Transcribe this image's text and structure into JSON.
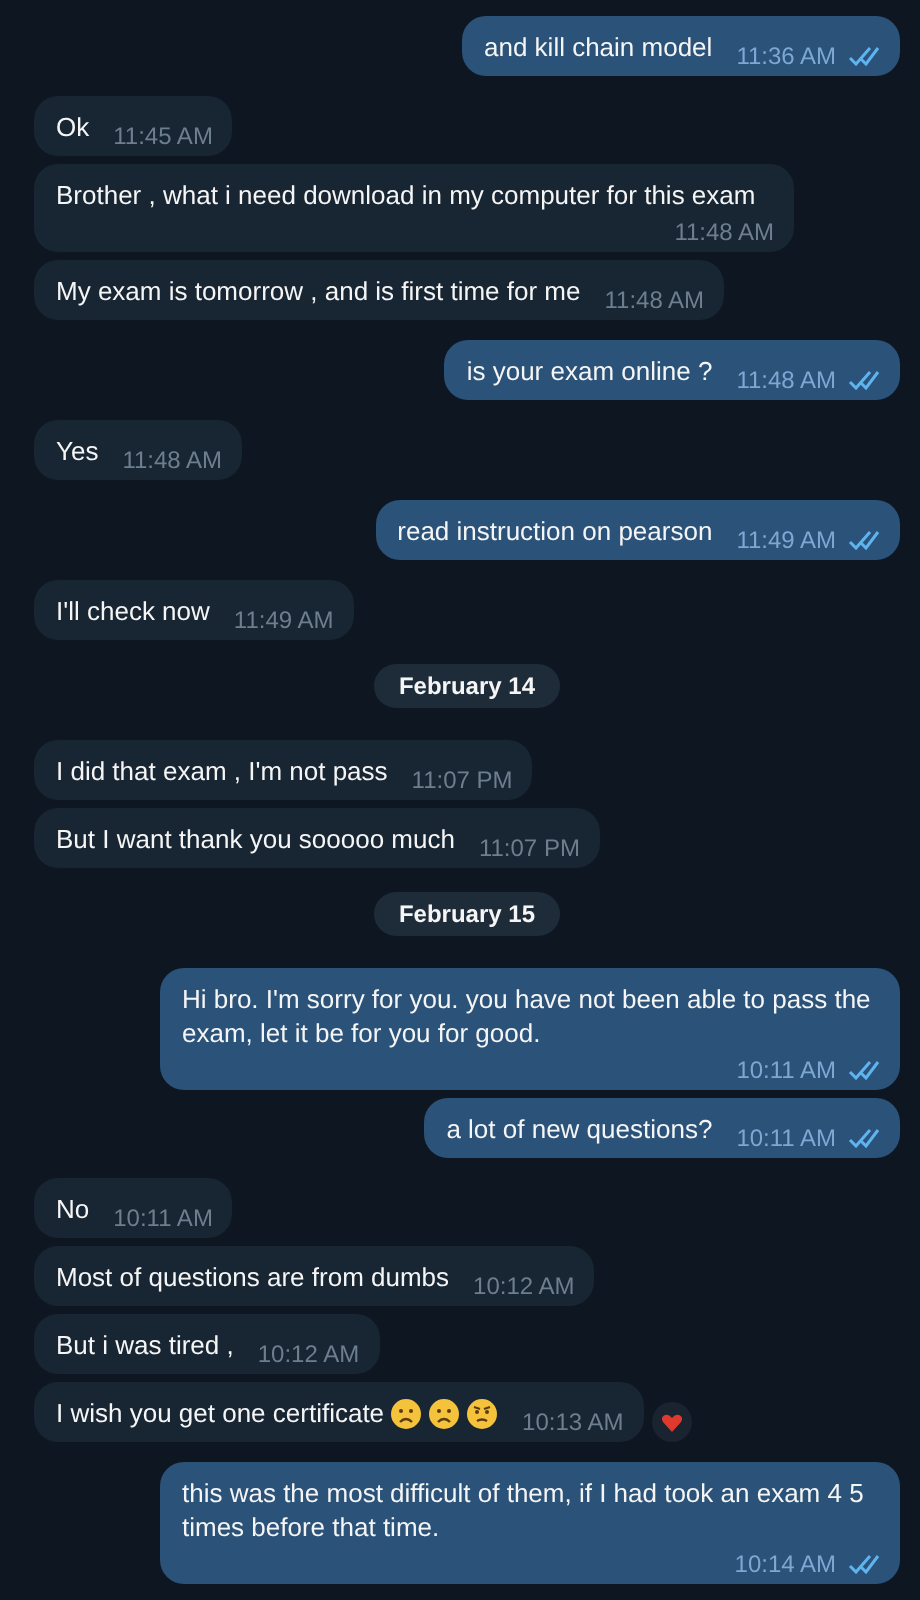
{
  "messages": [
    {
      "kind": "message",
      "outgoing": true,
      "text": "and kill chain model",
      "time": "11:36 AM",
      "read": true
    },
    {
      "kind": "message",
      "outgoing": false,
      "text": "Ok",
      "time": "11:45 AM"
    },
    {
      "kind": "message",
      "outgoing": false,
      "text": "Brother , what i need download  in my computer for this exam",
      "time": "11:48 AM"
    },
    {
      "kind": "message",
      "outgoing": false,
      "text": "My exam is tomorrow , and is first time for me",
      "time": "11:48 AM"
    },
    {
      "kind": "message",
      "outgoing": true,
      "text": "is your exam online ?",
      "time": "11:48 AM",
      "read": true
    },
    {
      "kind": "message",
      "outgoing": false,
      "text": "Yes",
      "time": "11:48 AM"
    },
    {
      "kind": "message",
      "outgoing": true,
      "text": "read instruction on pearson",
      "time": "11:49 AM",
      "read": true
    },
    {
      "kind": "message",
      "outgoing": false,
      "text": "I'll check now",
      "time": "11:49 AM"
    },
    {
      "kind": "date",
      "text": "February 14"
    },
    {
      "kind": "message",
      "outgoing": false,
      "text": "I did that exam , I'm not pass",
      "time": "11:07 PM"
    },
    {
      "kind": "message",
      "outgoing": false,
      "text": "But I want thank you sooooo much",
      "time": "11:07 PM"
    },
    {
      "kind": "date",
      "text": "February 15"
    },
    {
      "kind": "message",
      "outgoing": true,
      "text": "Hi bro. I'm sorry for you. you have not been able to pass the exam, let it be for you for good.",
      "time": "10:11 AM",
      "read": true
    },
    {
      "kind": "message",
      "outgoing": true,
      "text": "a lot of new questions?",
      "time": "10:11 AM",
      "read": true
    },
    {
      "kind": "message",
      "outgoing": false,
      "text": "No",
      "time": "10:11 AM"
    },
    {
      "kind": "message",
      "outgoing": false,
      "text": "Most of questions are from dumbs",
      "time": "10:12 AM"
    },
    {
      "kind": "message",
      "outgoing": false,
      "text": "But i was tired ,",
      "time": "10:12 AM"
    },
    {
      "kind": "message",
      "outgoing": false,
      "text": "I wish you get one certificate",
      "time": "10:13 AM",
      "emojis": [
        {
          "kind": "frown"
        },
        {
          "kind": "frown"
        },
        {
          "kind": "worried"
        }
      ],
      "reaction": {
        "kind": "heart"
      }
    },
    {
      "kind": "message",
      "outgoing": true,
      "text": "this was the most difficult of them, if I had took an exam 4 5 times before that time.",
      "time": "10:14 AM",
      "read": true
    }
  ]
}
